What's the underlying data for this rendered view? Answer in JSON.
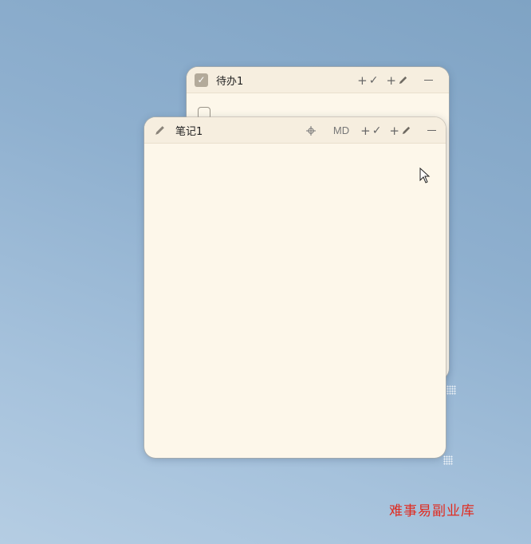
{
  "todo_window": {
    "title": "待办1",
    "icon": "checkbox-checked-icon",
    "actions": [
      {
        "icon": "add-todo-icon",
        "symbol": "+✓"
      },
      {
        "icon": "add-note-icon",
        "symbol": "+✎"
      }
    ],
    "minimize_icon": "minimize-icon"
  },
  "note_window": {
    "title": "笔记1",
    "icon": "pencil-icon",
    "pin_icon": "pin-icon",
    "md_label": "MD",
    "actions": [
      {
        "icon": "add-todo-icon",
        "symbol": "+✓"
      },
      {
        "icon": "add-note-icon",
        "symbol": "+✎"
      }
    ],
    "minimize_icon": "minimize-icon",
    "content": ""
  },
  "watermark": "难事易副业库",
  "colors": {
    "desktop": "#8fb0cf",
    "window_bg": "#fdf7ea",
    "titlebar_bg": "#f6eedf",
    "watermark": "#e02b20"
  }
}
